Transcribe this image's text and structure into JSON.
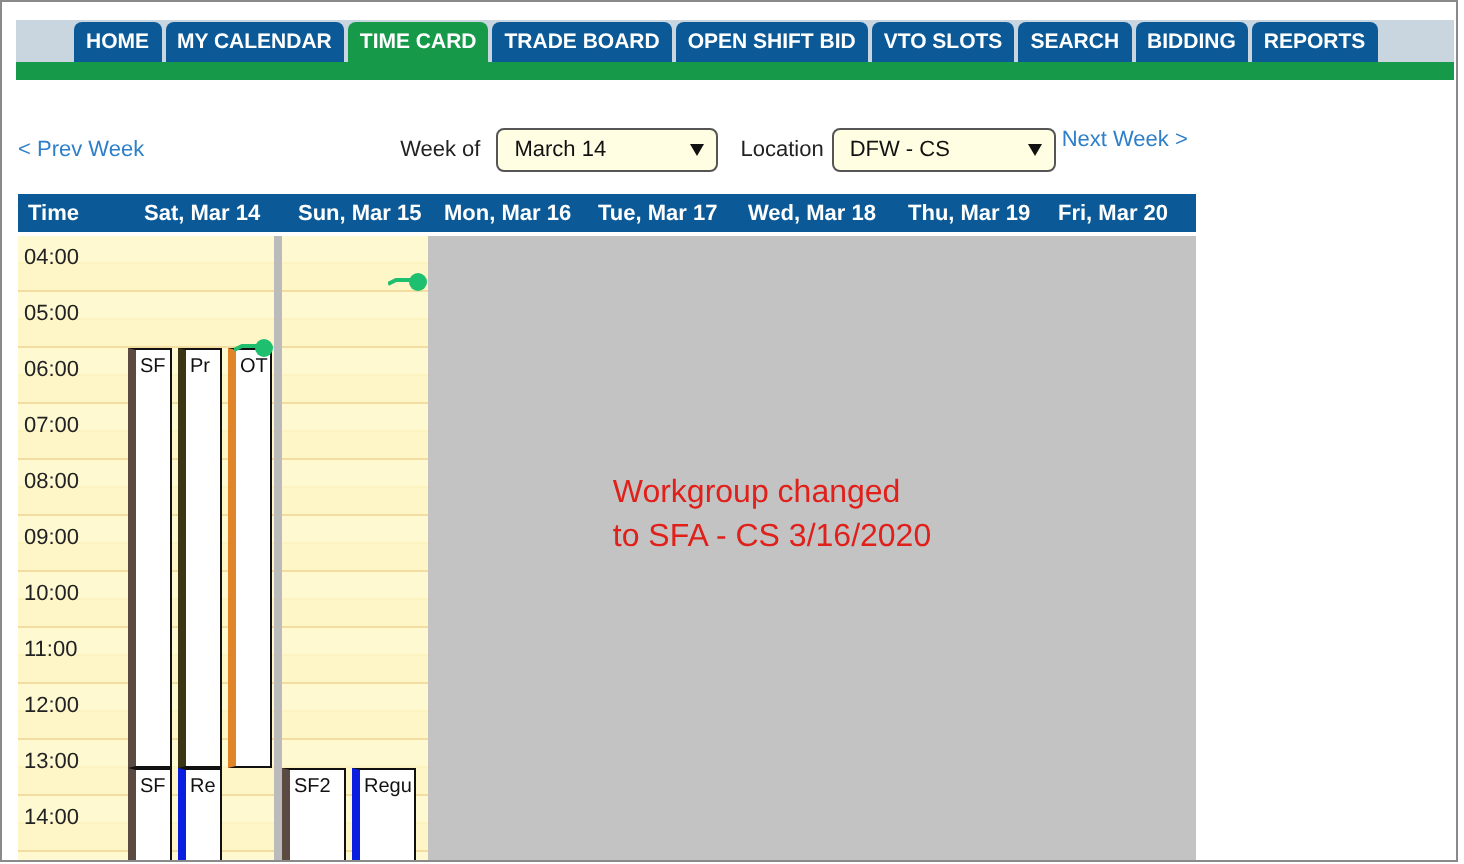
{
  "tabs": [
    {
      "label": "HOME",
      "selected": false
    },
    {
      "label": "MY CALENDAR",
      "selected": false
    },
    {
      "label": "TIME CARD",
      "selected": true
    },
    {
      "label": "TRADE BOARD",
      "selected": false
    },
    {
      "label": "OPEN SHIFT BID",
      "selected": false
    },
    {
      "label": "VTO SLOTS",
      "selected": false
    },
    {
      "label": "SEARCH",
      "selected": false
    },
    {
      "label": "BIDDING",
      "selected": false
    },
    {
      "label": "REPORTS",
      "selected": false
    }
  ],
  "navigation": {
    "previous": "< Prev Week",
    "next": "Next Week >",
    "week_label": "Week of",
    "week_value": "March 14",
    "location_label": "Location",
    "location_value": "DFW - CS"
  },
  "calendar": {
    "columns": [
      "Time",
      "Sat, Mar 14",
      "Sun, Mar 15",
      "Mon, Mar 16",
      "Tue, Mar 17",
      "Wed, Mar 18",
      "Thu, Mar 19",
      "Fri, Mar 20"
    ],
    "hours": [
      "04:00",
      "05:00",
      "06:00",
      "07:00",
      "08:00",
      "09:00",
      "10:00",
      "11:00",
      "12:00",
      "13:00",
      "14:00"
    ],
    "days": [
      {
        "events": [
          {
            "label": "SF",
            "color": "#5b4a42"
          },
          {
            "label": "Pr",
            "color": "#3b3516"
          },
          {
            "label": "OT",
            "color": "#e0852a"
          },
          {
            "label": "SF",
            "color": "#5b4a42"
          },
          {
            "label": "Re",
            "color": "#0a1ee0"
          }
        ]
      },
      {
        "events": [
          {
            "label": "SF2",
            "color": "#5b4a42"
          },
          {
            "label": "Regu",
            "color": "#0a1ee0"
          }
        ]
      }
    ],
    "notice": "Workgroup changed\nto SFA - CS 3/16/2020"
  }
}
